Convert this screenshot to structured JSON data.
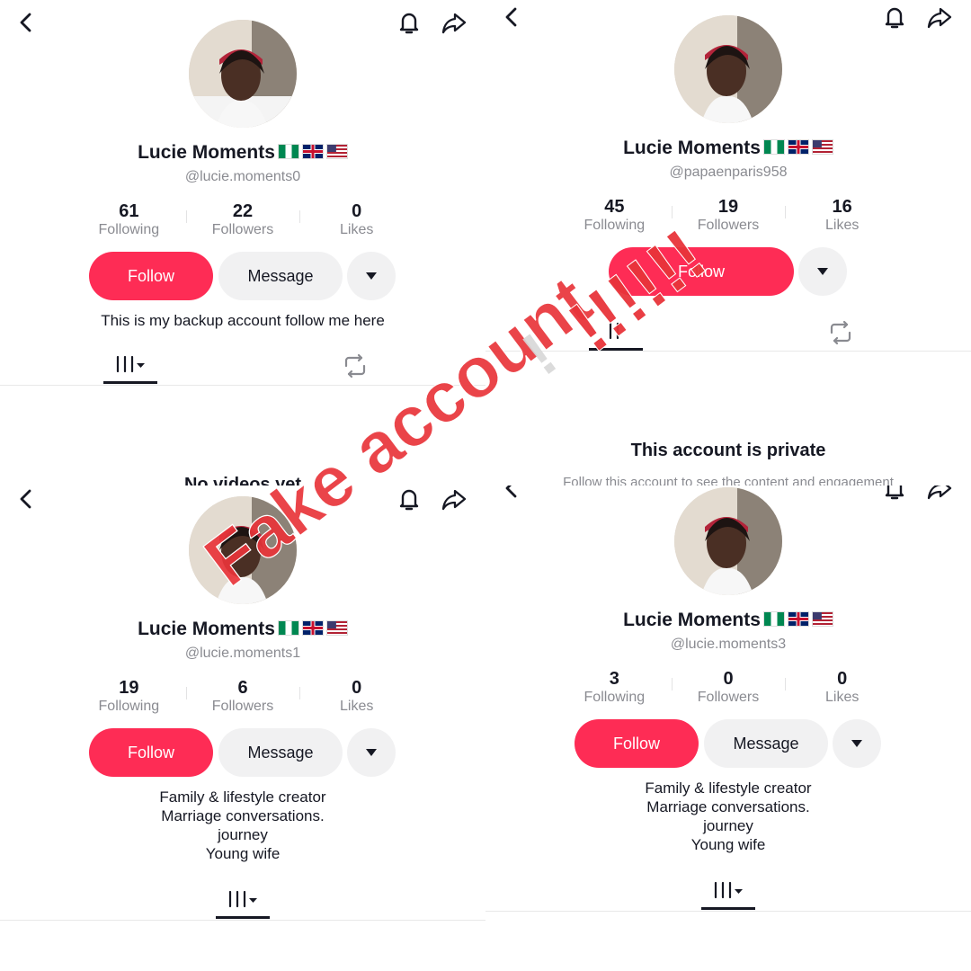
{
  "colors": {
    "follow_bg": "#fe2c55",
    "secondary_bg": "#f1f1f2",
    "muted_text": "#8a8b91",
    "stamp_red": "#e8343a"
  },
  "labels": {
    "following": "Following",
    "followers": "Followers",
    "likes": "Likes",
    "follow": "Follow",
    "message": "Message"
  },
  "panels": {
    "tl": {
      "name": "Lucie Moments",
      "handle": "@lucie.moments0",
      "following": "61",
      "followers": "22",
      "likes": "0",
      "bio": [
        "This is my backup account follow me here"
      ],
      "empty_text": "No videos yet"
    },
    "tr": {
      "name": "Lucie Moments",
      "handle": "@papaenparis958",
      "following": "45",
      "followers": "19",
      "likes": "16",
      "private_title": "This account is private",
      "private_sub": "Follow this account to see the content and engagement"
    },
    "bl": {
      "name": "Lucie Moments",
      "handle": "@lucie.moments1",
      "following": "19",
      "followers": "6",
      "likes": "0",
      "bio": [
        "Family & lifestyle creator",
        "Marriage conversations.",
        "journey",
        "Young wife"
      ]
    },
    "br": {
      "name": "Lucie Moments",
      "handle": "@lucie.moments3",
      "following": "3",
      "followers": "0",
      "likes": "0",
      "bio": [
        "Family & lifestyle creator",
        "Marriage conversations.",
        "journey",
        "Young wife"
      ]
    }
  },
  "overlay": {
    "stamp_text": "Fake account",
    "exclaim": "!!!!!!"
  },
  "icons": [
    "back-arrow-icon",
    "bell-icon",
    "share-icon",
    "grid-videos-icon",
    "repost-icon",
    "dropdown-caret-icon"
  ]
}
